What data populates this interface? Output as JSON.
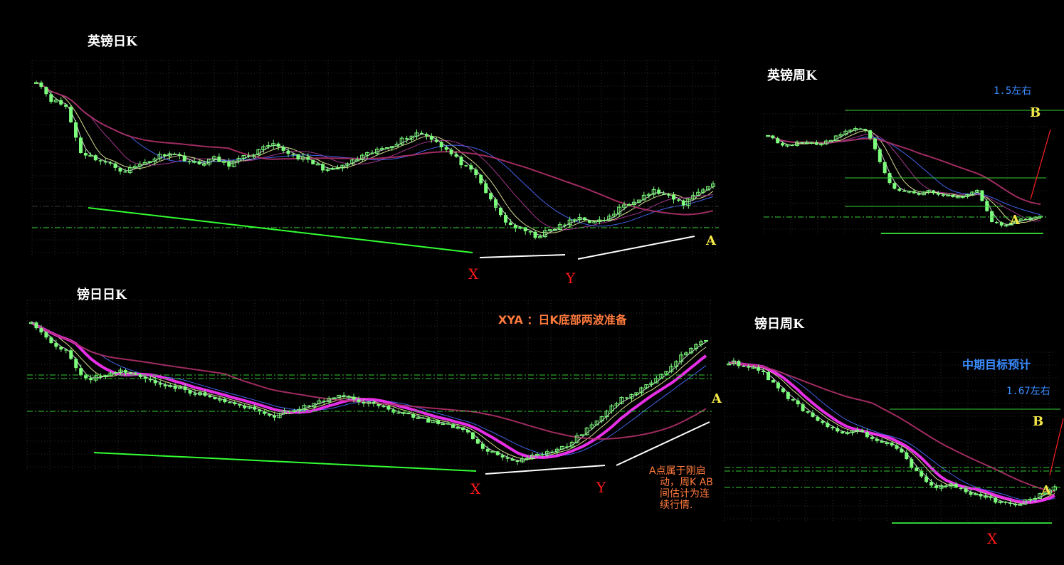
{
  "colors": {
    "background": "#000000",
    "grid": "#2a2a2a",
    "candle_up": "#7dff7d",
    "candle_down": "#7dff7d",
    "ma_white": "#e8e8e8",
    "ma_yellow": "#f2f2a0",
    "ma_blue": "#4a6cff",
    "ma_purple": "#b03a9a",
    "ma_maroon": "#b0306a",
    "ma_magenta": "#ff33ff",
    "trend_green": "#33ff33",
    "trend_white": "#ffffff",
    "level_green": "#33cc33",
    "arrow_red": "#ff2020",
    "label_red": "#ff1a1a",
    "label_yellow": "#f5e84a",
    "label_blue": "#3a8cff",
    "note_orange": "#ff7a3d"
  },
  "chart_data": [
    {
      "type": "candlestick",
      "title": "英镑日K",
      "closes": [
        1.55,
        1.52,
        1.51,
        1.44,
        1.43,
        1.42,
        1.41,
        1.42,
        1.43,
        1.44,
        1.43,
        1.42,
        1.43,
        1.42,
        1.43,
        1.44,
        1.45,
        1.44,
        1.43,
        1.42,
        1.41,
        1.42,
        1.43,
        1.44,
        1.45,
        1.46,
        1.47,
        1.46,
        1.44,
        1.42,
        1.4,
        1.36,
        1.33,
        1.32,
        1.31,
        1.32,
        1.33,
        1.34,
        1.33,
        1.34,
        1.36,
        1.37,
        1.38,
        1.37,
        1.36,
        1.38,
        1.39
      ],
      "annotations": [
        {
          "text": "X"
        },
        {
          "text": "Y"
        },
        {
          "text": "A"
        }
      ]
    },
    {
      "type": "candlestick",
      "title": "镑日日K",
      "closes": [
        1.52,
        1.48,
        1.46,
        1.4,
        1.41,
        1.42,
        1.41,
        1.4,
        1.39,
        1.38,
        1.37,
        1.36,
        1.35,
        1.34,
        1.33,
        1.34,
        1.35,
        1.36,
        1.37,
        1.36,
        1.35,
        1.34,
        1.33,
        1.32,
        1.31,
        1.3,
        1.27,
        1.25,
        1.24,
        1.25,
        1.26,
        1.27,
        1.3,
        1.33,
        1.36,
        1.38,
        1.4,
        1.43,
        1.46,
        1.48
      ],
      "annotations": [
        {
          "text": "X"
        },
        {
          "text": "Y"
        },
        {
          "text": "A"
        }
      ],
      "notes": {
        "headline": "XYA  ：日K底部两波准备",
        "side": [
          "A点属于刚启",
          "动，周K AB",
          "间估计为连",
          "续行情."
        ]
      }
    },
    {
      "type": "candlestick",
      "title": "英镑周K",
      "closes": [
        1.7,
        1.66,
        1.67,
        1.68,
        1.67,
        1.68,
        1.7,
        1.72,
        1.71,
        1.62,
        1.54,
        1.53,
        1.52,
        1.53,
        1.52,
        1.51,
        1.52,
        1.53,
        1.44,
        1.43,
        1.44,
        1.45,
        1.46
      ],
      "annotations": [
        {
          "text": "1.5左右"
        },
        {
          "text": "B"
        },
        {
          "text": "A"
        }
      ]
    },
    {
      "type": "candlestick",
      "title": "镑日周K",
      "closes": [
        1.95,
        1.94,
        1.93,
        1.9,
        1.86,
        1.82,
        1.79,
        1.76,
        1.74,
        1.72,
        1.73,
        1.71,
        1.69,
        1.68,
        1.62,
        1.58,
        1.55,
        1.56,
        1.54,
        1.53,
        1.52,
        1.5,
        1.5,
        1.51,
        1.53,
        1.56
      ],
      "annotations": [
        {
          "text": "中期目标预计"
        },
        {
          "text": "1.67左右"
        },
        {
          "text": "B"
        },
        {
          "text": "A"
        },
        {
          "text": "X"
        }
      ]
    }
  ]
}
